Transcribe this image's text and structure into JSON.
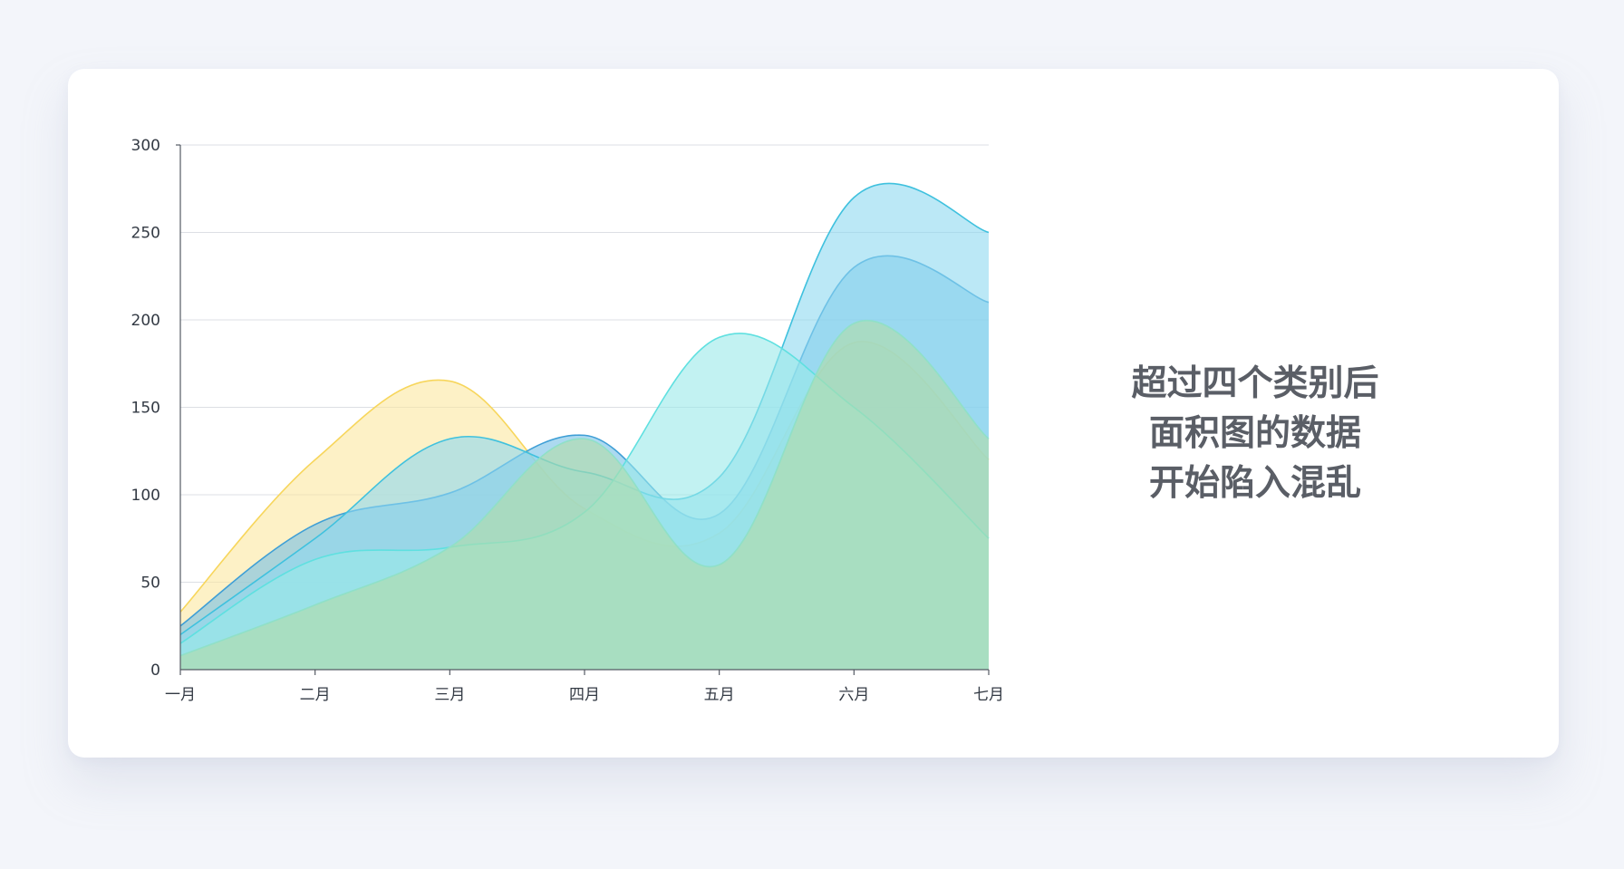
{
  "caption": {
    "lines": [
      "超过四个类别后",
      "面积图的数据",
      "开始陷入混乱"
    ]
  },
  "colors": {
    "background": "#f3f5fa",
    "card": "#ffffff",
    "caption": "#5a5e66"
  },
  "chart_data": {
    "type": "area",
    "categories": [
      "一月",
      "二月",
      "三月",
      "四月",
      "五月",
      "六月",
      "七月"
    ],
    "ylim": [
      0,
      300
    ],
    "yticks": [
      0,
      50,
      100,
      150,
      200,
      250,
      300
    ],
    "grid": true,
    "series": [
      {
        "values": [
          33,
          120,
          165,
          92,
          78,
          187,
          120
        ],
        "color": "#f7d65c",
        "fill": "#fbe8a0"
      },
      {
        "values": [
          25,
          83,
          101,
          134,
          89,
          230,
          210
        ],
        "color": "#3f9fd6",
        "fill": "#74c0e6"
      },
      {
        "values": [
          20,
          75,
          132,
          113,
          110,
          270,
          250
        ],
        "color": "#3fc1de",
        "fill": "#8ed8f0"
      },
      {
        "values": [
          15,
          63,
          70,
          90,
          190,
          150,
          75
        ],
        "color": "#5fe0e0",
        "fill": "#9aeaea"
      },
      {
        "values": [
          8,
          37,
          70,
          132,
          60,
          198,
          132
        ],
        "color": "#8fe0c8",
        "fill": "#b3dca6"
      }
    ]
  }
}
